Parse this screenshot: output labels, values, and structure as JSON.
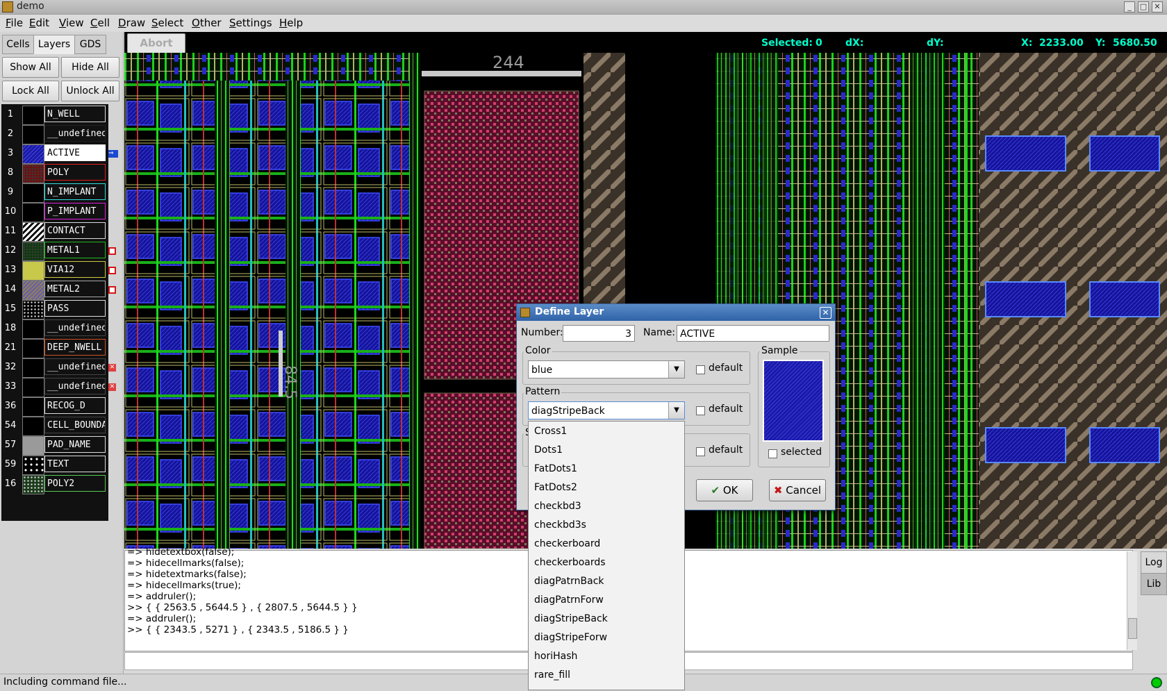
{
  "window": {
    "title": "demo"
  },
  "menu": [
    "File",
    "Edit",
    "View",
    "Cell",
    "Draw",
    "Select",
    "Other",
    "Settings",
    "Help"
  ],
  "tabs": [
    "Cells",
    "Layers",
    "GDS"
  ],
  "layer_buttons": {
    "show_all": "Show All",
    "hide_all": "Hide All",
    "lock_all": "Lock All",
    "unlock_all": "Unlock All"
  },
  "layers": [
    {
      "num": "1",
      "name": "N_WELL",
      "color": "#000000",
      "pattern": "solid",
      "border": "#dddddd",
      "flag": ""
    },
    {
      "num": "2",
      "name": "__undefined",
      "color": "#000000",
      "pattern": "solid",
      "border": "#222222",
      "flag": ""
    },
    {
      "num": "3",
      "name": "ACTIVE",
      "color": "#1a1aa8",
      "pattern": "diag",
      "border": "#ffffff",
      "flag": "arrow",
      "selected": true
    },
    {
      "num": "8",
      "name": "POLY",
      "color": "#6a1212",
      "pattern": "dots",
      "border": "#dd2222",
      "flag": ""
    },
    {
      "num": "9",
      "name": "N_IMPLANT",
      "color": "#000000",
      "pattern": "solid",
      "border": "#33dddd",
      "flag": ""
    },
    {
      "num": "10",
      "name": "P_IMPLANT",
      "color": "#000000",
      "pattern": "solid",
      "border": "#dd22dd",
      "flag": ""
    },
    {
      "num": "11",
      "name": "CONTACT",
      "color": "#ffffff",
      "pattern": "stripes",
      "border": "#dddddd",
      "flag": ""
    },
    {
      "num": "12",
      "name": "METAL1",
      "color": "#0f3a0f",
      "pattern": "dots",
      "border": "#22bb22",
      "flag": "lock"
    },
    {
      "num": "13",
      "name": "VIA12",
      "color": "#c8c84a",
      "pattern": "solid",
      "border": "#cccc44",
      "flag": "lock"
    },
    {
      "num": "14",
      "name": "METAL2",
      "color": "#8a7a66",
      "pattern": "diag",
      "border": "#aaaaaa",
      "flag": "lock"
    },
    {
      "num": "15",
      "name": "PASS",
      "color": "#000000",
      "pattern": "cross",
      "border": "#dddddd",
      "flag": ""
    },
    {
      "num": "18",
      "name": "__undefined",
      "color": "#000000",
      "pattern": "solid",
      "border": "#444444",
      "flag": ""
    },
    {
      "num": "21",
      "name": "DEEP_NWELL",
      "color": "#000000",
      "pattern": "solid",
      "border": "#cc5522",
      "flag": ""
    },
    {
      "num": "32",
      "name": "__undefined",
      "color": "#000000",
      "pattern": "solid",
      "border": "#444444",
      "flag": "x"
    },
    {
      "num": "33",
      "name": "__undefined",
      "color": "#000000",
      "pattern": "solid",
      "border": "#444444",
      "flag": "x"
    },
    {
      "num": "36",
      "name": "RECOG_D",
      "color": "#000000",
      "pattern": "solid",
      "border": "#dddddd",
      "flag": ""
    },
    {
      "num": "54",
      "name": "CELL_BOUNDARY",
      "color": "#000000",
      "pattern": "solid",
      "border": "#444444",
      "flag": ""
    },
    {
      "num": "57",
      "name": "PAD_NAME",
      "color": "#9a9a9a",
      "pattern": "solid",
      "border": "#dddddd",
      "flag": ""
    },
    {
      "num": "59",
      "name": "TEXT",
      "color": "#000000",
      "pattern": "bigdots",
      "border": "#dddddd",
      "flag": ""
    },
    {
      "num": "16",
      "name": "POLY2",
      "color": "#1a3a1a",
      "pattern": "cross",
      "border": "#55cc55",
      "flag": ""
    }
  ],
  "toolbar": {
    "abort": "Abort"
  },
  "coords": {
    "selected_label": "Selected:",
    "selected": "0",
    "dx_label": "dX:",
    "dy_label": "dY:",
    "x_label": "X:",
    "x": "2233.00",
    "y_label": "Y:",
    "y": "5680.50"
  },
  "canvas_labels": {
    "top": "244",
    "vertical": "84.5"
  },
  "console_lines": [
    "=> hidetextbox(false);",
    "=> hidecellmarks(false);",
    "=> hidetextmarks(false);",
    "=> hidecellmarks(true);",
    "=> addruler();",
    ">> { { 2563.5 , 5644.5 } , { 2807.5 , 5644.5 } }",
    "=> addruler();",
    ">> { { 2343.5 , 5271 } , { 2343.5 , 5186.5 } }"
  ],
  "side_tabs": [
    "Log",
    "Lib"
  ],
  "status": {
    "text": "Including command file..."
  },
  "dialog": {
    "title": "Define Layer",
    "number_label": "Number:",
    "number_value": "3",
    "name_label": "Name:",
    "name_value": "ACTIVE",
    "color_group": "Color",
    "color_value": "blue",
    "pattern_group": "Pattern",
    "pattern_value": "diagStripeBack",
    "third_group_fragment": "S",
    "default_label": "default",
    "sample_group": "Sample",
    "sample_color": "#1a1aa8",
    "selected_label": "selected",
    "ok": "OK",
    "cancel": "Cancel"
  },
  "pattern_options": [
    "Cross1",
    "Dots1",
    "FatDots1",
    "FatDots2",
    "checkbd3",
    "checkbd3s",
    "checkerboard",
    "checkerboards",
    "diagPatrnBack",
    "diagPatrnForw",
    "diagStripeBack",
    "diagStripeForw",
    "horiHash",
    "rare_fill"
  ]
}
